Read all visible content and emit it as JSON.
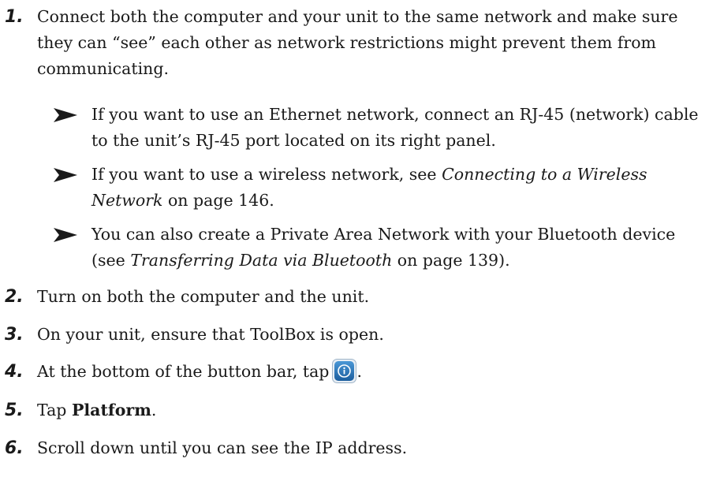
{
  "steps": [
    {
      "num": "1.",
      "text": "Connect both the computer and your unit to the same network and make sure they can “see” each other as network restrictions might prevent them from communicating."
    },
    {
      "num": "2.",
      "text": "Turn on both the computer and the unit."
    },
    {
      "num": "3.",
      "text": "On your unit, ensure that ToolBox is open."
    },
    {
      "num": "4.",
      "text": "At the bottom of the button bar, tap",
      "end": ".",
      "icon": "info-icon"
    },
    {
      "num": "5.",
      "prefix": "Tap ",
      "bold": "Platform",
      "end": "."
    },
    {
      "num": "6.",
      "text": "Scroll down until you can see the IP address."
    }
  ],
  "substeps": [
    {
      "text": "If you want to use an Ethernet network, connect an RJ-45 (network) cable to the unit’s RJ-45 port located on its right panel."
    },
    {
      "prefix": "If you want to use a wireless network, see ",
      "italic": "Connecting to a Wireless Network",
      "suffix": " on page 146."
    },
    {
      "prefix": "You can also create a Private Area Network with your Bluetooth device (see ",
      "italic": "Transferring Data via Bluetooth",
      "suffix": " on page 139)."
    }
  ],
  "colors": {
    "text": "#1a1a1a",
    "icon_fill": "#1f6fb3",
    "icon_border": "#9fb4c8"
  }
}
